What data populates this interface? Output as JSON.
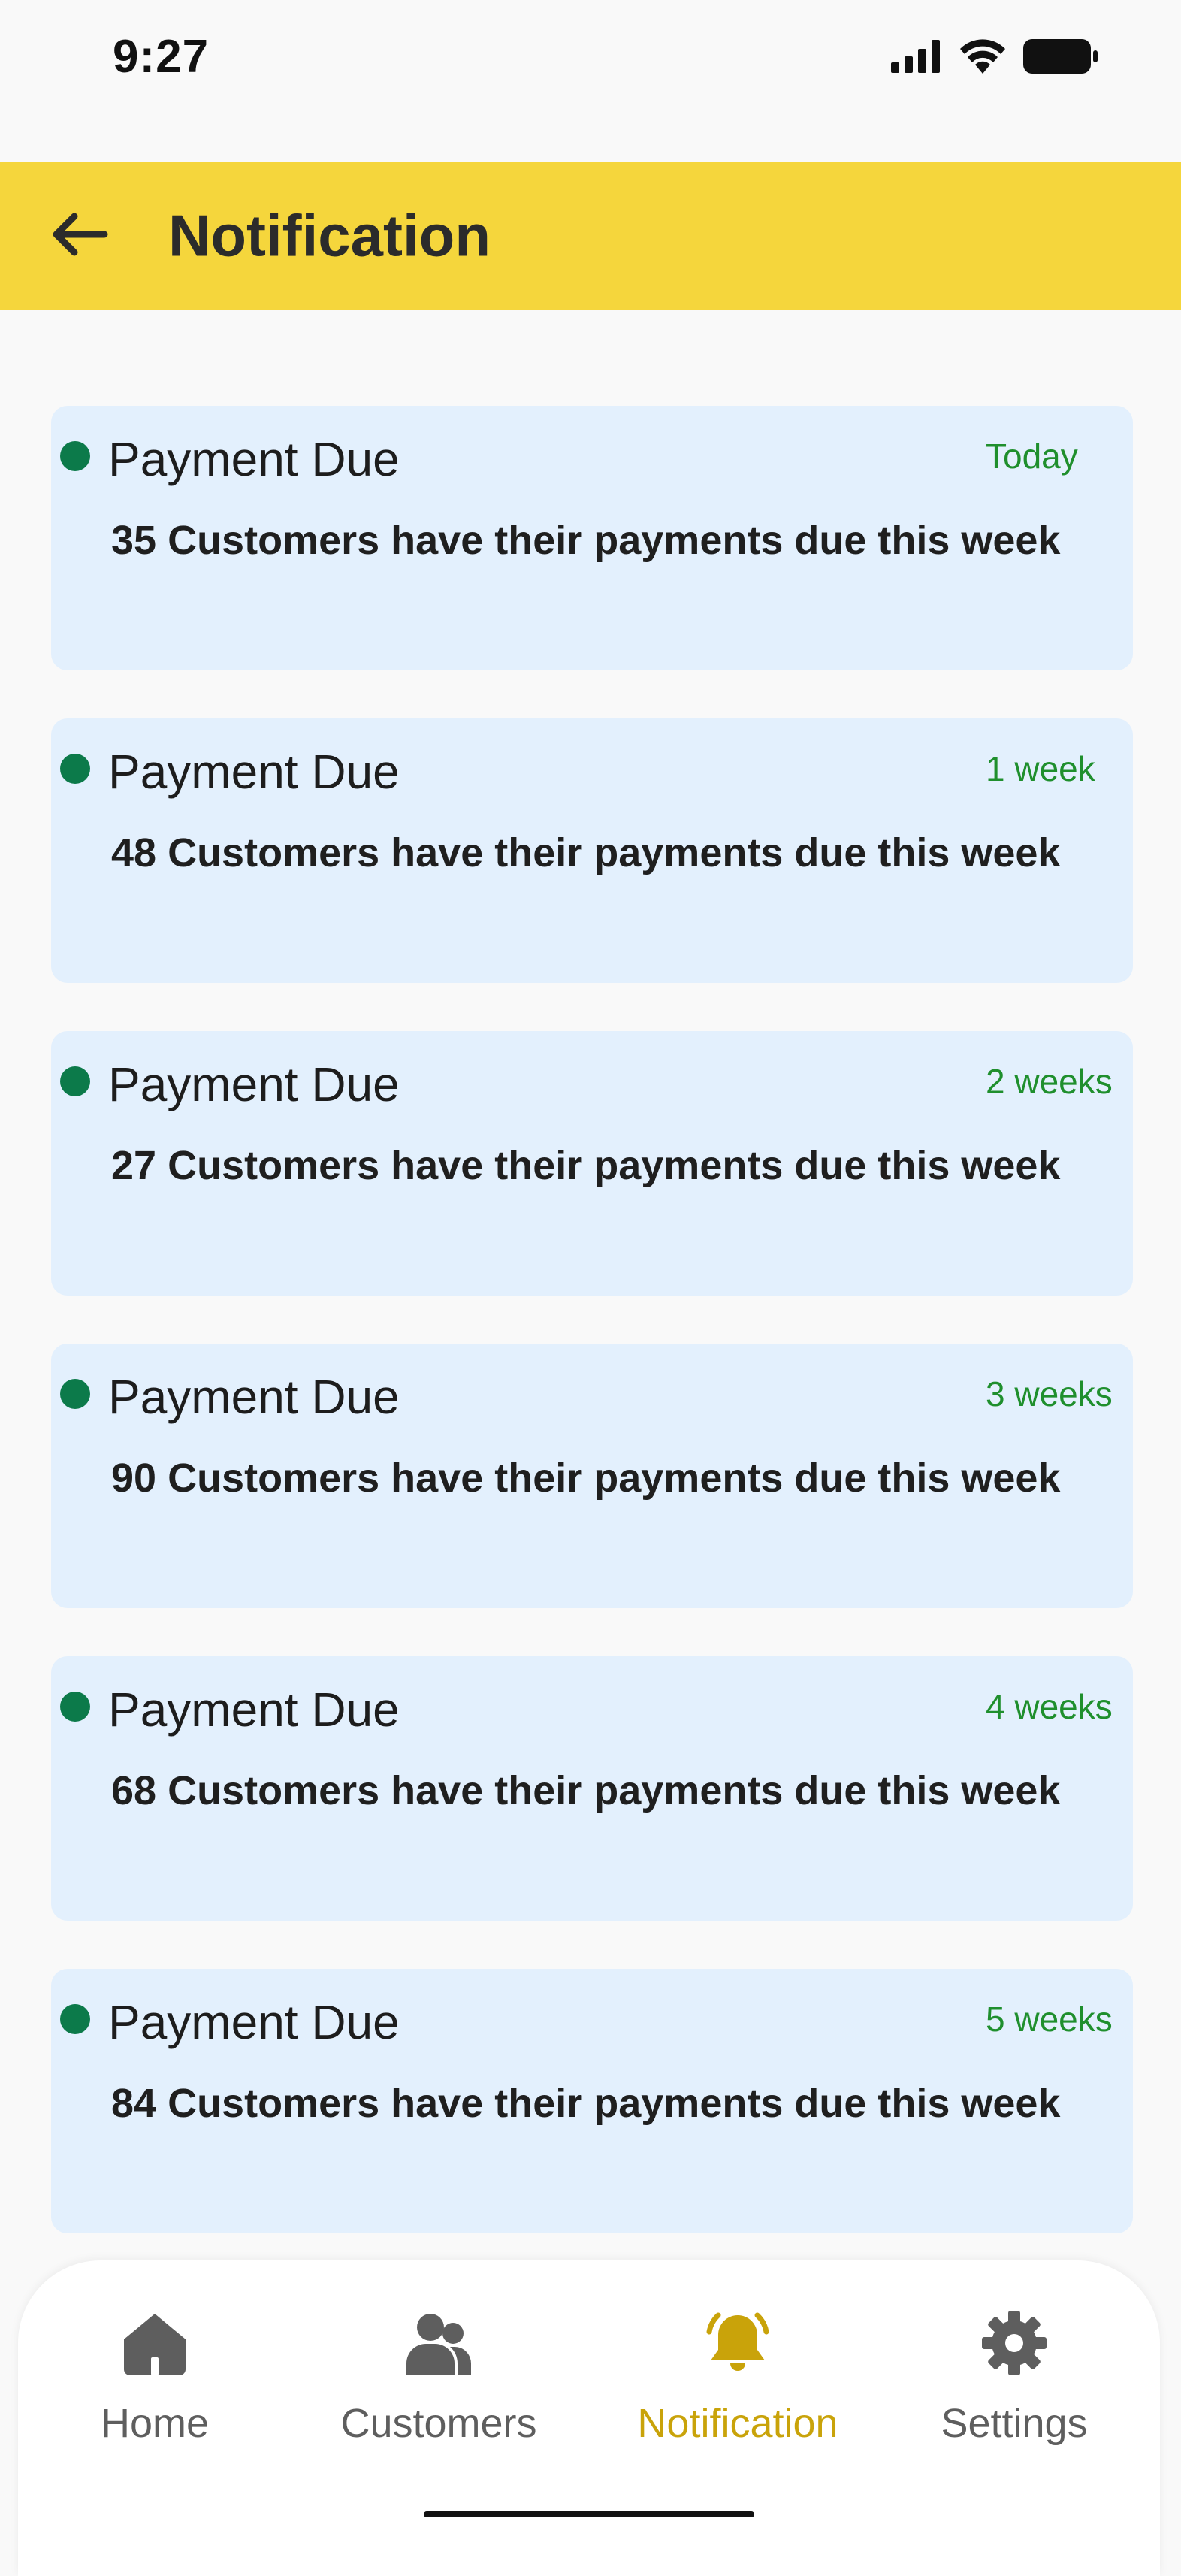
{
  "status_bar": {
    "time": "9:27",
    "icons": [
      "signal-icon",
      "wifi-icon",
      "battery-icon"
    ]
  },
  "app_bar": {
    "title": "Notification",
    "back_icon": "arrow-left-icon",
    "background": "#f5d63c"
  },
  "notifications": [
    {
      "title": "Payment Due",
      "time": "Today",
      "message": "35 Customers have their payments due this week"
    },
    {
      "title": "Payment Due",
      "time": "1 week",
      "message": "48 Customers have their payments due this week"
    },
    {
      "title": "Payment Due",
      "time": "2 weeks",
      "message": "27 Customers have their payments due this week"
    },
    {
      "title": "Payment Due",
      "time": "3 weeks",
      "message": "90 Customers have their payments due this week"
    },
    {
      "title": "Payment Due",
      "time": "4 weeks",
      "message": "68 Customers have their payments due this week"
    },
    {
      "title": "Payment Due",
      "time": "5 weeks",
      "message": "84 Customers have their payments due this week"
    }
  ],
  "bottom_nav": {
    "items": [
      {
        "label": "Home",
        "icon": "home-icon"
      },
      {
        "label": "Customers",
        "icon": "users-icon"
      },
      {
        "label": "Notification",
        "icon": "bell-icon",
        "active": true
      },
      {
        "label": "Settings",
        "icon": "gear-icon"
      }
    ],
    "active_color": "#c9a30a",
    "inactive_color": "#5e5e5e"
  },
  "colors": {
    "card_background": "#e3f0fd",
    "unread_dot": "#0c7a4a",
    "time_text": "#1f8f2d"
  }
}
